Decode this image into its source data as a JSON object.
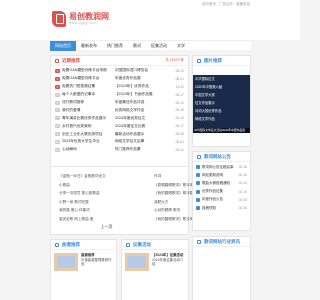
{
  "header": {
    "logo_title": "易创教润网",
    "logo_sub": "www.qgzjy.com",
    "top_links": [
      "设为首页",
      "广告合作",
      "收藏本站"
    ]
  },
  "nav": [
    "网站首页",
    "最新发布",
    "热门推荐",
    "歌词",
    "征集活动",
    "文学"
  ],
  "main_list": {
    "title": "近期推荐",
    "extra": "共 21670 条",
    "items": [
      {
        "num": "1",
        "text": "免费GAN模型训练平台申报",
        "date": ""
      },
      {
        "num": "2",
        "text": "免费GAN模型训练平台",
        "date": ""
      },
      {
        "num": "3",
        "text": "免费热门短视频征集",
        "date": ""
      },
      {
        "num": "4",
        "text": "每个人都爱的记事本",
        "date": ""
      },
      {
        "num": "5",
        "text": "流行歌词推荐",
        "date": ""
      },
      {
        "num": "6",
        "text": "我们的爱情",
        "date": ""
      },
      {
        "num": "7",
        "text": "青年演讲比赛优秀作品展示",
        "date": ""
      },
      {
        "num": "8",
        "text": "乡村振兴优秀案例",
        "date": ""
      },
      {
        "num": "9",
        "text": "创业工业化大赛优秀项目",
        "date": ""
      },
      {
        "num": "10",
        "text": "2023年优秀大学生毕业",
        "date": ""
      },
      {
        "num": "11",
        "text": "心动瞬间",
        "date": ""
      }
    ],
    "right_items": [
      {
        "text": "中国国际进口博览会",
        "date": "08-12"
      },
      {
        "text": "年度优秀作品展",
        "date": "08-01"
      },
      {
        "text": "【2024年】优秀作品",
        "date": "14:22"
      },
      {
        "text": "【2024年】书画作品展",
        "date": "08-17"
      },
      {
        "text": "年度最佳作品评选",
        "date": "08-10"
      },
      {
        "text": "优秀网络文学作品",
        "date": "06-20"
      },
      {
        "text": "2024年度优秀征文",
        "date": "06-10"
      },
      {
        "text": "2024年度征文比赛",
        "date": "06-17"
      },
      {
        "text": "最新活动作品展示",
        "date": "06-08"
      },
      {
        "text": "网络文学征文启事",
        "date": "06-01"
      },
      {
        "text": "热门推荐作品集",
        "date": "05-21"
      }
    ]
  },
  "info_rows": [
    [
      "《金瓶一年日》金瓶歌词全文",
      "作词"
    ],
    [
      "小歌曲",
      "《原唱翻唱歌词》歌手简"
    ],
    [
      "分享一次愿意 更心愿歌曲",
      "《我的翻唱歌词》歌手翻唱"
    ],
    [
      "小野一身 歌词完整",
      "减肥大方"
    ],
    [
      "我的路 爱心 伴奏词",
      "心动的眼睛 歌词"
    ],
    [
      "高安全歌 网上歌曲 爱",
      "《我的翻唱歌词》歌手简"
    ]
  ],
  "pager": {
    "prev": "上一页",
    "next": "下一页"
  },
  "side_image": {
    "title": "图片推荐",
    "rows": [
      "中华国际征文",
      "2020年中国第六届",
      "中国文学大赛",
      "征文作品展示",
      "诗词大赛优秀作品",
      "网络文学作品"
    ],
    "caption": "中华国际文学征文活动2020年中国作品展"
  },
  "side_list1": {
    "title": "歌词网站公告",
    "items": [
      {
        "text": "歌词网公告征稿启事",
        "date": "02-18"
      },
      {
        "text": "网站更新说明",
        "date": "02-16"
      },
      {
        "text": "歌曲大赛投稿通知",
        "date": "02-12"
      },
      {
        "text": "优秀作品征集",
        "date": "02-10"
      },
      {
        "text": "年度作品公告",
        "date": "02-08"
      },
      {
        "text": "投稿须知",
        "date": "02-05"
      }
    ]
  },
  "side_list2": {
    "title": "歌词网站行业资讯"
  },
  "bottom_cards": [
    {
      "title": "曲谱推荐",
      "item": "曲谱推荐",
      "desc": "乐谱曲谱整理推荐作品"
    },
    {
      "title": "征集活动",
      "item": "【2024年】征集活动",
      "desc": "2024年度征集活动介绍"
    }
  ]
}
